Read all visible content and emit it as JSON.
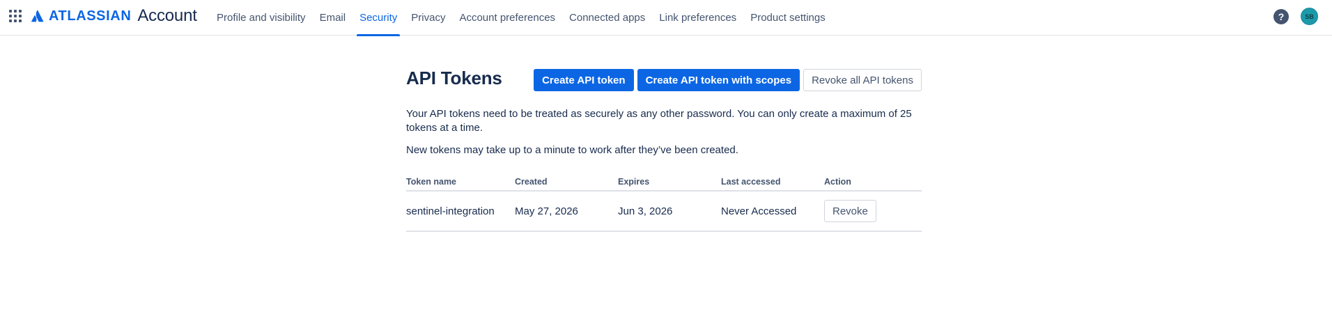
{
  "header": {
    "logo_text": "ATLASSIAN",
    "product_text": "Account",
    "nav": [
      {
        "label": "Profile and visibility",
        "active": false
      },
      {
        "label": "Email",
        "active": false
      },
      {
        "label": "Security",
        "active": true
      },
      {
        "label": "Privacy",
        "active": false
      },
      {
        "label": "Account preferences",
        "active": false
      },
      {
        "label": "Connected apps",
        "active": false
      },
      {
        "label": "Link preferences",
        "active": false
      },
      {
        "label": "Product settings",
        "active": false
      }
    ],
    "help_glyph": "?",
    "avatar_initials": "SB",
    "icons": {
      "app_switcher": "grid-9-dots-icon",
      "help": "help-icon",
      "logo": "atlassian-logo-icon"
    }
  },
  "page": {
    "title": "API Tokens",
    "buttons": {
      "create": "Create API token",
      "create_scoped": "Create API token with scopes",
      "revoke_all": "Revoke all API tokens"
    },
    "description": "Your API tokens need to be treated as securely as any other password. You can only create a maximum of 25 tokens at a time.",
    "note": "New tokens may take up to a minute to work after they’ve been created."
  },
  "table": {
    "columns": [
      "Token name",
      "Created",
      "Expires",
      "Last accessed",
      "Action"
    ],
    "rows": [
      {
        "name": "sentinel-integration",
        "created": "May 27, 2026",
        "expires": "Jun 3, 2026",
        "last_accessed": "Never Accessed",
        "action": "Revoke"
      }
    ]
  },
  "colors": {
    "accent": "#0c66e4",
    "text": "#172b4d",
    "subtle_text": "#44546f",
    "border": "#dfe1e6",
    "avatar_bg": "#1d9aaa"
  }
}
